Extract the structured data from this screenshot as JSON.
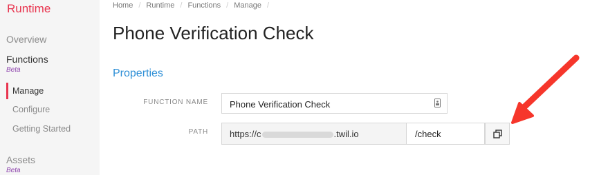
{
  "sidebar": {
    "brand": "Runtime",
    "overview": "Overview",
    "functions": "Functions",
    "functions_badge": "Beta",
    "subnav": [
      "Manage",
      "Configure",
      "Getting Started"
    ],
    "assets": "Assets",
    "assets_badge": "Beta"
  },
  "breadcrumb": [
    "Home",
    "Runtime",
    "Functions",
    "Manage"
  ],
  "page_title": "Phone Verification Check",
  "section_title": "Properties",
  "form": {
    "function_name_label": "FUNCTION NAME",
    "function_name_value": "Phone Verification Check",
    "path_label": "PATH",
    "url_prefix": "https://c",
    "url_suffix": ".twil.io",
    "path_value": "/check"
  },
  "colors": {
    "brand": "#e8344e",
    "section": "#2e8fd6",
    "beta": "#8e44ad",
    "annotation_arrow": "#f6362b"
  }
}
